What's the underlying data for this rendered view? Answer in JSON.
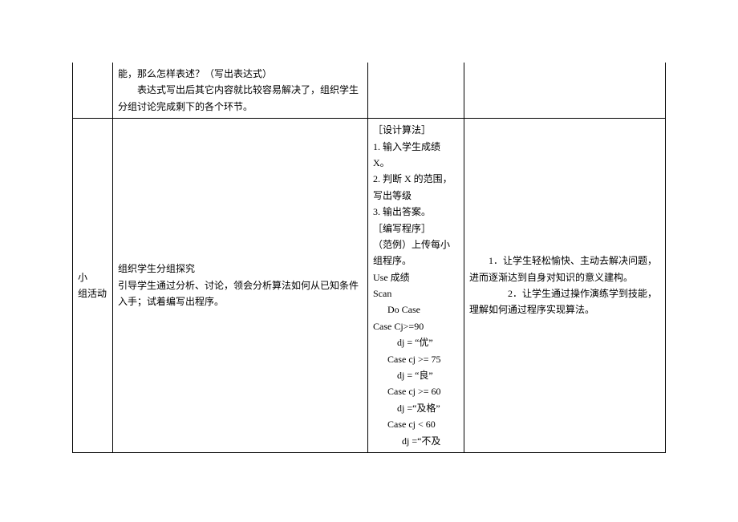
{
  "row_top": {
    "col2_line1": "能，那么怎样表述？（写出表达式）",
    "col2_line2": "表达式写出后其它内容就比较容易解决了，组织学生分组讨论完成剩下的各个环节。"
  },
  "row_main": {
    "col1_line1": "小",
    "col1_line2": "组活动",
    "col2_line1": "组织学生分组探究",
    "col2_line2": "引导学生通过分析、讨论，领会分析算法如何从已知条件入手；试着编写出程序。",
    "col3": {
      "h1": "［设计算法］",
      "s1": "1. 输入学生成绩 X。",
      "s2": "2. 判断 X 的范围，写出等级",
      "s3": "3. 输出答案。",
      "h2": "［编写程序］",
      "s4": "（范例）上传每小组程序。",
      "code1": "Use 成绩",
      "code2": "Scan",
      "code3": "Do Case",
      "code4": "Case Cj>=90",
      "code5": "dj = “优”",
      "code6": "Case cj >= 75",
      "code7": "dj = “良”",
      "code8": "Case cj >= 60",
      "code9": "dj =“及格”",
      "code10": "Case cj < 60",
      "code11": "dj =“不及"
    },
    "col4_p1": "1．让学生轻松愉快、主动去解决问题，进而逐渐达到自身对知识的意义建构。",
    "col4_p2_pre": "2．",
    "col4_p2": "让学生通过操作演练学到技能，理解如何通过程序实现算法。"
  }
}
